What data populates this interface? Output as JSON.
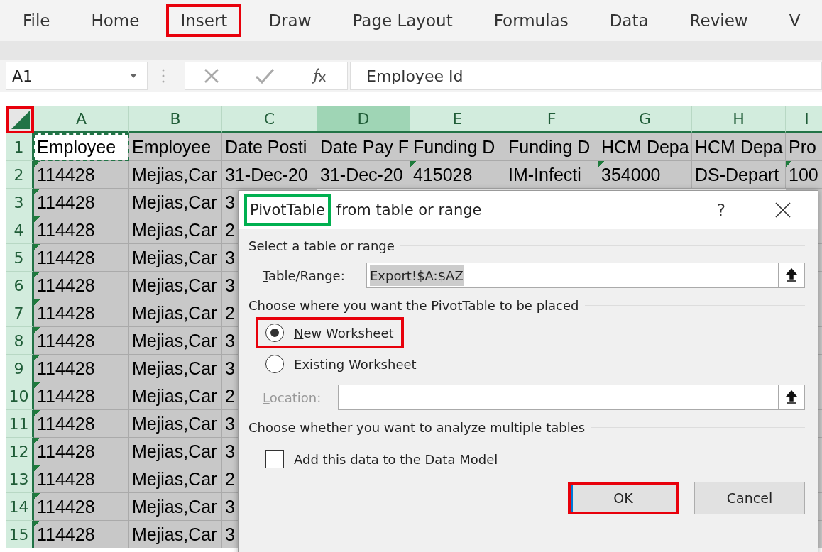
{
  "ribbon_tabs": [
    {
      "label": "File",
      "marked": false
    },
    {
      "label": "Home",
      "marked": false
    },
    {
      "label": "Insert",
      "marked": true
    },
    {
      "label": "Draw",
      "marked": false
    },
    {
      "label": "Page Layout",
      "marked": false
    },
    {
      "label": "Formulas",
      "marked": false
    },
    {
      "label": "Data",
      "marked": false
    },
    {
      "label": "Review",
      "marked": false
    },
    {
      "label": "V",
      "marked": false
    }
  ],
  "formula_bar": {
    "name_box": "A1",
    "formula": "Employee Id"
  },
  "select_all": {
    "marked": true
  },
  "columns": [
    {
      "label": "A",
      "selected": false
    },
    {
      "label": "B",
      "selected": false
    },
    {
      "label": "C",
      "selected": false
    },
    {
      "label": "D",
      "selected": true
    },
    {
      "label": "E",
      "selected": false
    },
    {
      "label": "F",
      "selected": false
    },
    {
      "label": "G",
      "selected": false
    },
    {
      "label": "H",
      "selected": false
    },
    {
      "label": "I",
      "selected": false
    }
  ],
  "rows": [
    {
      "number": "1",
      "cells": [
        "Employee",
        "Employee",
        "Date Posti",
        "Date Pay F",
        "Funding D",
        "Funding D",
        "HCM Depa",
        "HCM Depa",
        "Pro"
      ],
      "flagged": [
        false,
        false,
        false,
        false,
        false,
        false,
        false,
        false,
        false
      ]
    },
    {
      "number": "2",
      "cells": [
        "114428",
        "Mejias,Car",
        "31-Dec-20",
        "31-Dec-20",
        "415028",
        "IM-Infecti",
        "354000",
        "DS-Depart",
        "100"
      ],
      "flagged": [
        true,
        false,
        false,
        false,
        true,
        false,
        true,
        false,
        true
      ]
    },
    {
      "number": "3",
      "cells": [
        "114428",
        "Mejias,Car",
        "3"
      ],
      "flagged": [
        true,
        false,
        false
      ]
    },
    {
      "number": "4",
      "cells": [
        "114428",
        "Mejias,Car",
        "2"
      ],
      "flagged": [
        true,
        false,
        false
      ]
    },
    {
      "number": "5",
      "cells": [
        "114428",
        "Mejias,Car",
        "3"
      ],
      "flagged": [
        true,
        false,
        false
      ]
    },
    {
      "number": "6",
      "cells": [
        "114428",
        "Mejias,Car",
        "3"
      ],
      "flagged": [
        true,
        false,
        false
      ]
    },
    {
      "number": "7",
      "cells": [
        "114428",
        "Mejias,Car",
        "2"
      ],
      "flagged": [
        true,
        false,
        false
      ]
    },
    {
      "number": "8",
      "cells": [
        "114428",
        "Mejias,Car",
        "3"
      ],
      "flagged": [
        true,
        false,
        false
      ]
    },
    {
      "number": "9",
      "cells": [
        "114428",
        "Mejias,Car",
        "3"
      ],
      "flagged": [
        true,
        false,
        false
      ]
    },
    {
      "number": "10",
      "cells": [
        "114428",
        "Mejias,Car",
        "2"
      ],
      "flagged": [
        true,
        false,
        false
      ]
    },
    {
      "number": "11",
      "cells": [
        "114428",
        "Mejias,Car",
        "3"
      ],
      "flagged": [
        true,
        false,
        false
      ]
    },
    {
      "number": "12",
      "cells": [
        "114428",
        "Mejias,Car",
        "3"
      ],
      "flagged": [
        true,
        false,
        false
      ]
    },
    {
      "number": "13",
      "cells": [
        "114428",
        "Mejias,Car",
        "2"
      ],
      "flagged": [
        true,
        false,
        false
      ]
    },
    {
      "number": "14",
      "cells": [
        "114428",
        "Mejias,Car",
        "3"
      ],
      "flagged": [
        true,
        false,
        false
      ]
    },
    {
      "number": "15",
      "cells": [
        "114428",
        "Mejias,Car",
        "3"
      ],
      "flagged": [
        true,
        false,
        false
      ]
    }
  ],
  "dialog": {
    "title_parts": [
      {
        "text": "PivotTable",
        "marked": true
      },
      {
        "text": "from table or range",
        "marked": false
      }
    ],
    "help": "?",
    "section_1": "Select a table or range",
    "table_range": {
      "label": {
        "key": "T",
        "after": "able/Range:"
      },
      "value": "Export!$A:$AZ"
    },
    "section_2": "Choose where you want the PivotTable to be placed",
    "placement": [
      {
        "label": {
          "key": "N",
          "after": "ew Worksheet"
        },
        "selected": true,
        "marked": true
      },
      {
        "label": {
          "key": "E",
          "after": "xisting Worksheet"
        },
        "selected": false,
        "marked": false
      }
    ],
    "location": {
      "label": {
        "key": "L",
        "after": "ocation:"
      },
      "disabled": true
    },
    "section_3": "Choose whether you want to analyze multiple tables",
    "data_model": {
      "label": {
        "before": "Add this data to the Data ",
        "key": "M",
        "after": "odel"
      },
      "checked": false
    },
    "buttons": [
      {
        "label": "OK",
        "default": true,
        "marked": true
      },
      {
        "label": "Cancel",
        "default": false,
        "marked": false
      }
    ]
  }
}
